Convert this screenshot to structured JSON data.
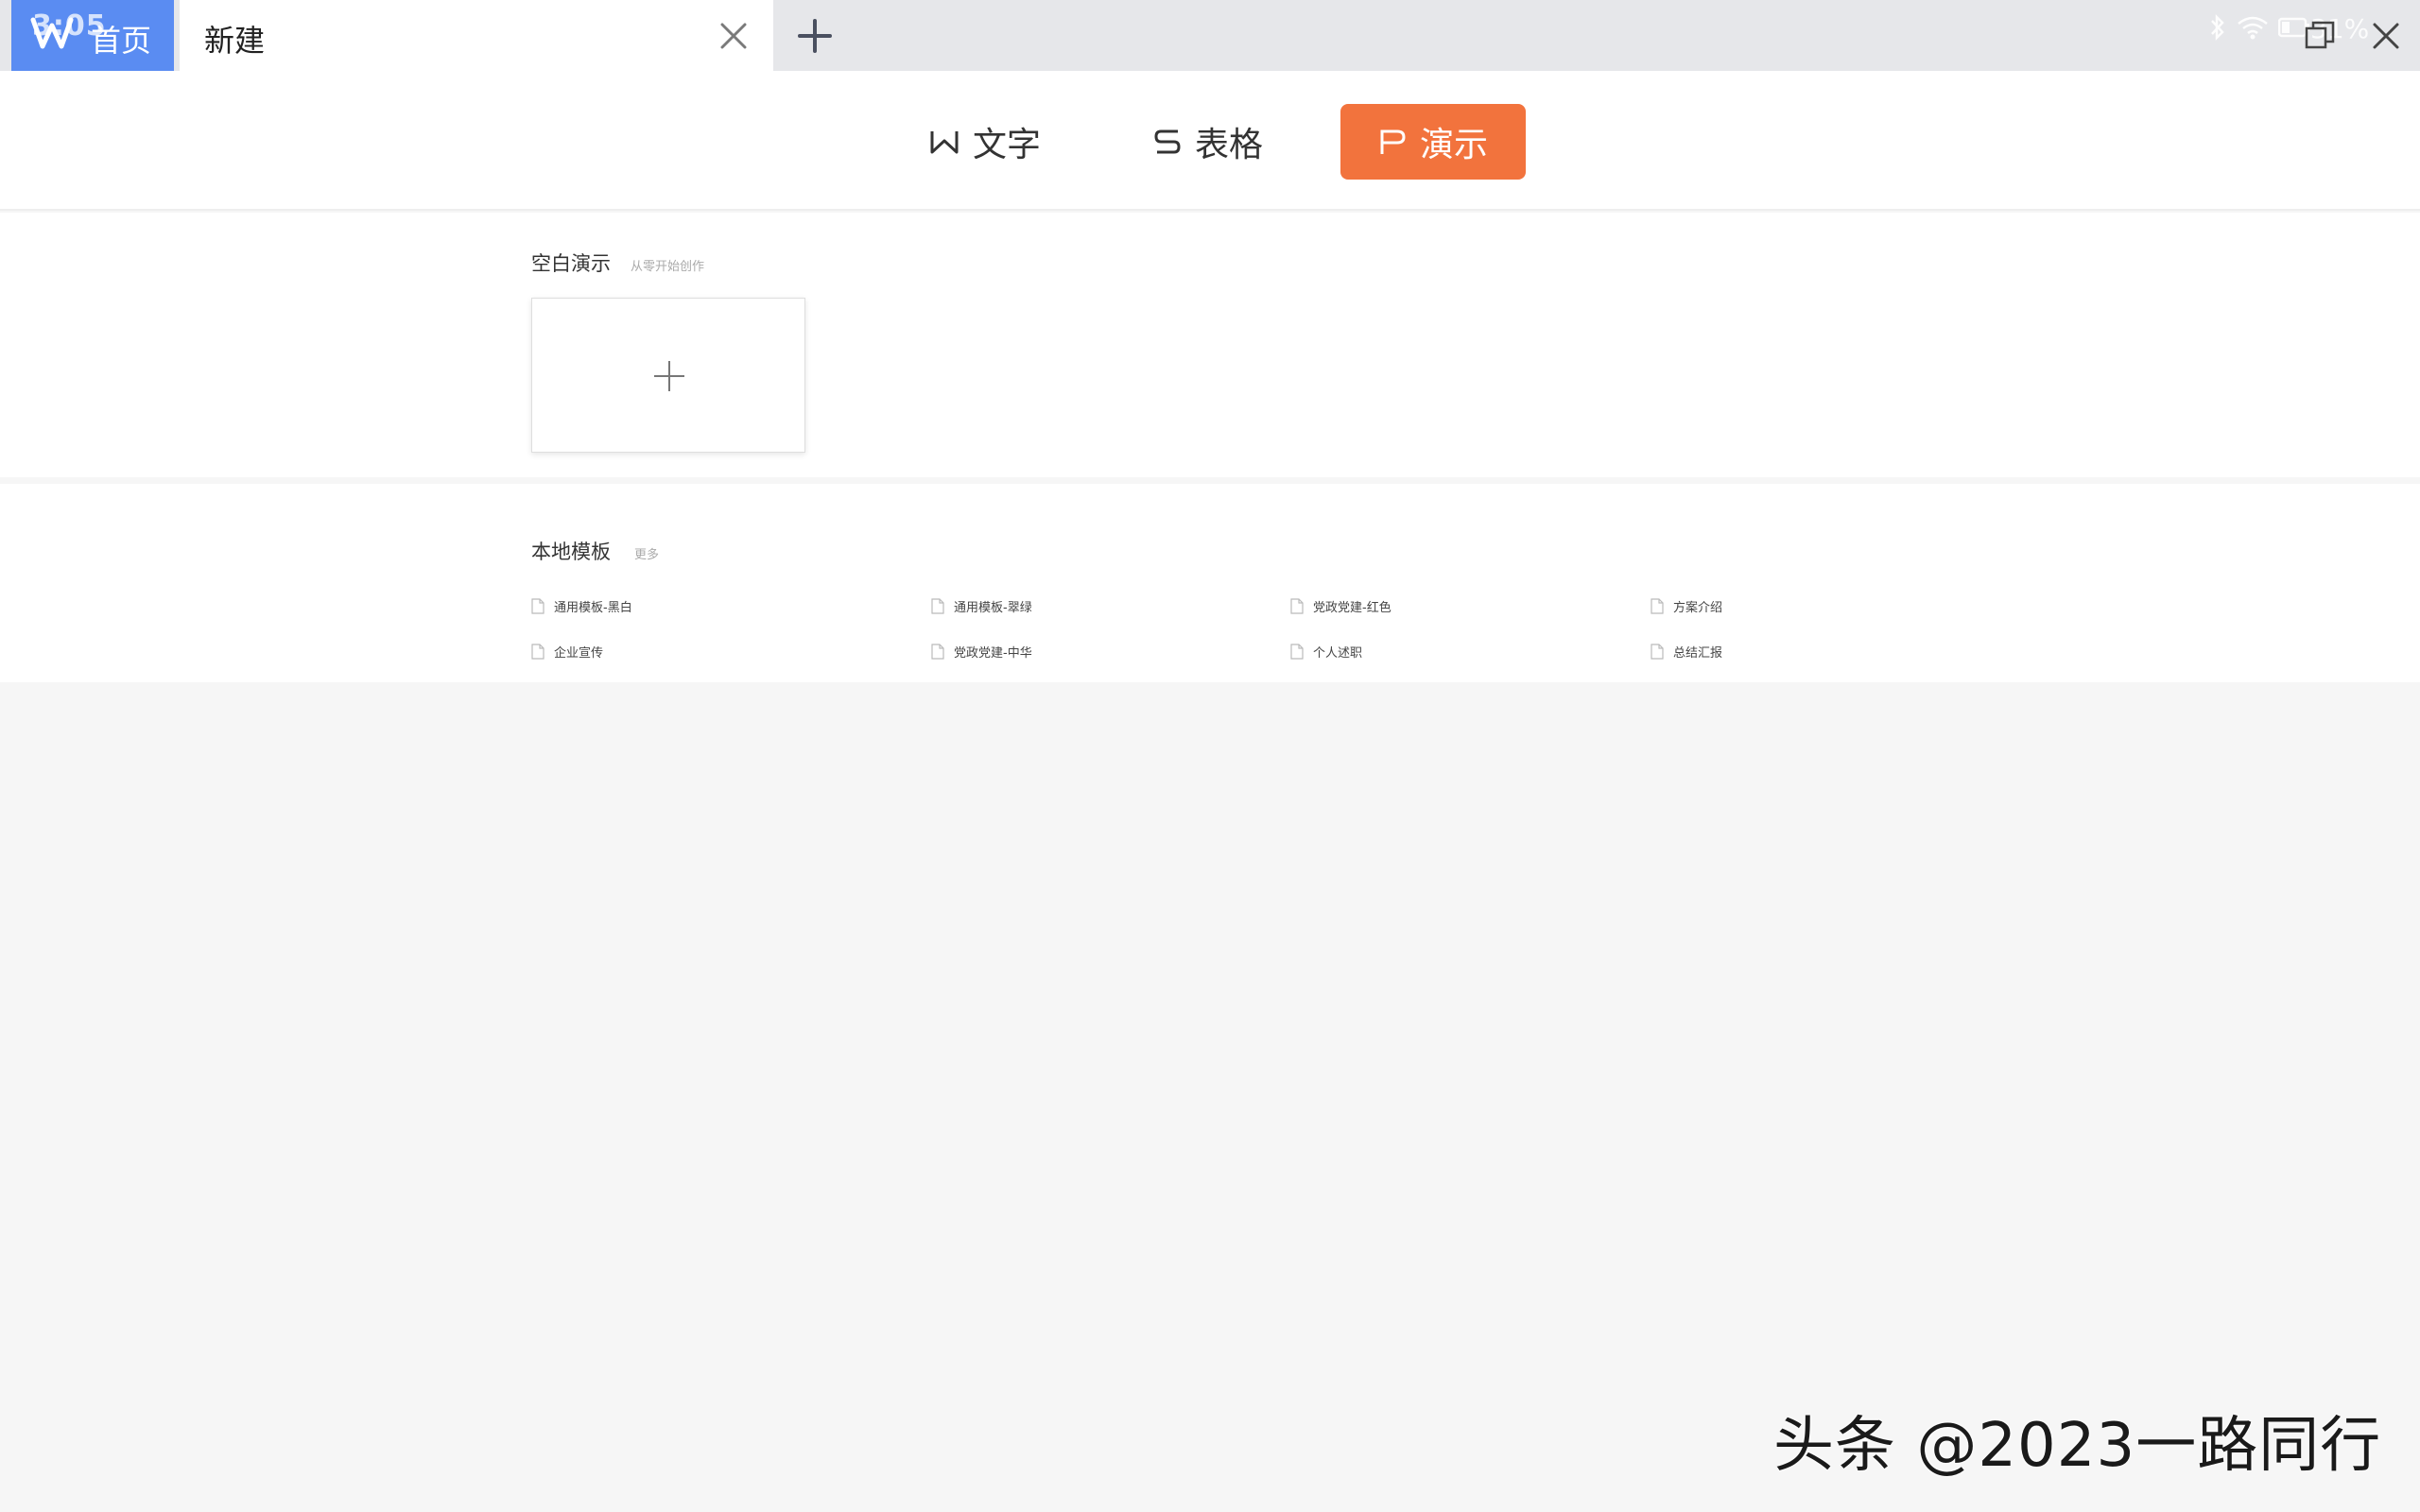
{
  "tabs": {
    "home_label": "首页",
    "status_time": "3:05",
    "document_label": "新建"
  },
  "status_bar": {
    "battery_text": "31%"
  },
  "type_switcher": {
    "items": [
      {
        "label": "文字",
        "glyph": "W"
      },
      {
        "label": "表格",
        "glyph": "S"
      },
      {
        "label": "演示",
        "glyph": "P",
        "active": true
      }
    ],
    "active_color": "#f2733d"
  },
  "blank_section": {
    "title": "空白演示",
    "subtitle": "从零开始创作"
  },
  "templates_section": {
    "title": "本地模板",
    "more_label": "更多",
    "items": [
      "通用模板-黑白",
      "通用模板-翠绿",
      "党政党建-红色",
      "方案介绍",
      "企业宣传",
      "党政党建-中华",
      "个人述职",
      "总结汇报"
    ]
  },
  "watermark": "头条 @2023一路同行",
  "colors": {
    "home_tab": "#5a8cf2",
    "tabbar": "#e6e7ea",
    "accent": "#f2733d"
  }
}
